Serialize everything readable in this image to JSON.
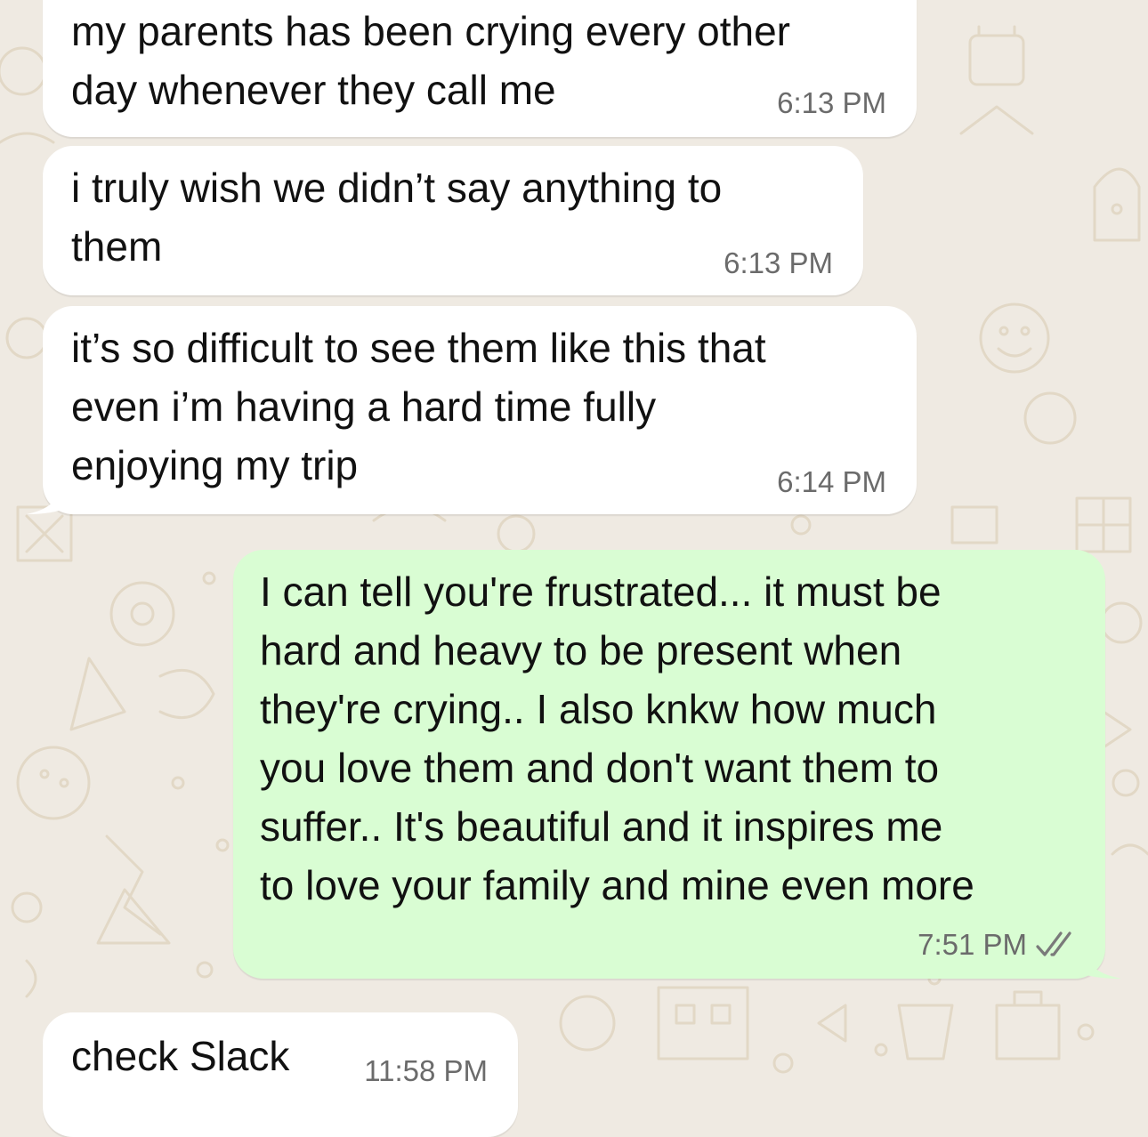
{
  "chat": {
    "messages": [
      {
        "direction": "incoming",
        "text": "my parents has been crying every other\nday whenever they call me",
        "time": "6:13 PM"
      },
      {
        "direction": "incoming",
        "text": "i truly wish we didn’t say anything to\nthem",
        "time": "6:13 PM"
      },
      {
        "direction": "incoming",
        "text": "it’s so difficult to see them like this that\neven i’m having a hard time fully\nenjoying my trip",
        "time": "6:14 PM"
      },
      {
        "direction": "outgoing",
        "text": "I can tell you're frustrated... it must be\nhard and heavy to be present when\nthey're crying.. I also knkw how much\nyou love them and don't want them to\nsuffer.. It's beautiful and it inspires me\nto love your family and mine even more",
        "time": "7:51 PM",
        "status": "read"
      },
      {
        "direction": "incoming",
        "text": "check Slack",
        "time": "11:58 PM"
      }
    ]
  },
  "theme": {
    "background": "#efeae2",
    "incoming_bubble": "#ffffff",
    "outgoing_bubble": "#d9fdd3",
    "doodle_color": "#e2d8c6",
    "read_tick_color": "#7a7a7a"
  },
  "icons": {
    "wallpaper": "doodle-pattern",
    "read_status": "double-check-icon"
  }
}
